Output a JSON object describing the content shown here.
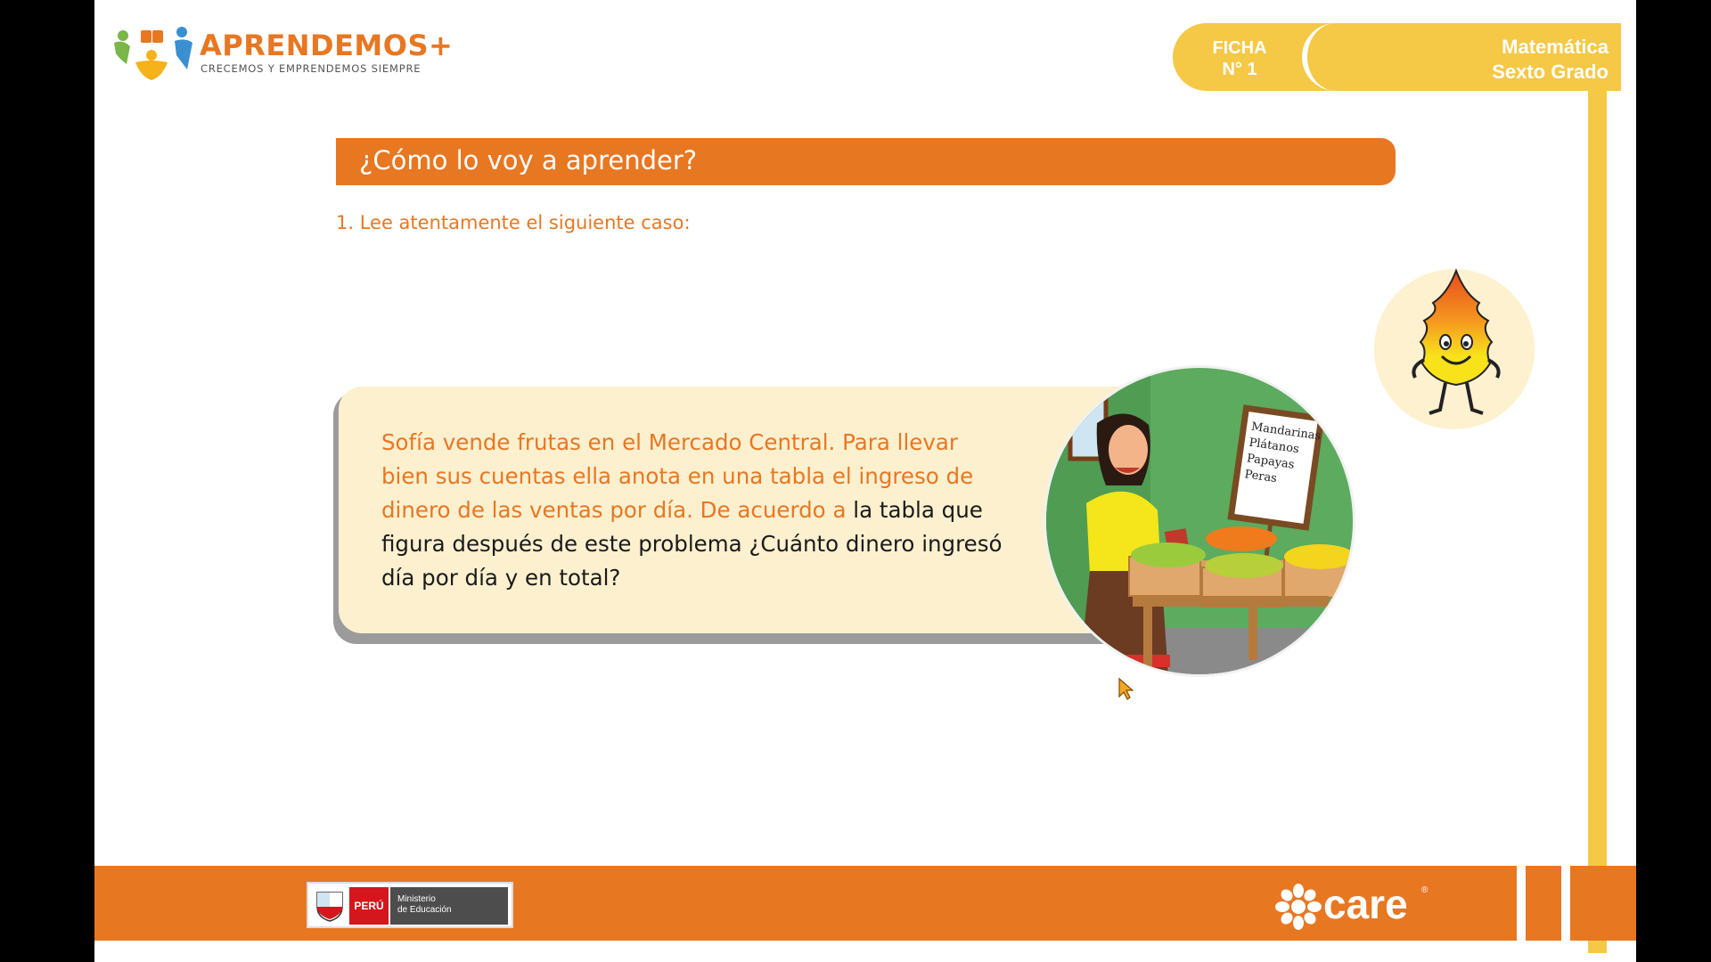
{
  "header": {
    "brand_title": "APRENDEMOS+",
    "brand_tagline": "CRECEMOS Y EMPRENDEMOS SIEMPRE",
    "ficha_line1": "FICHA",
    "ficha_line2": "N° 1",
    "subject_line1": "Matemática",
    "subject_line2": "Sexto Grado"
  },
  "section": {
    "title": "¿Cómo lo voy a aprender?",
    "step": "1. Lee atentamente el siguiente caso:"
  },
  "case": {
    "text_orange": "Sofía vende frutas en el Mercado Central. Para llevar bien sus cuentas ella anota en una tabla el ingreso de dinero de las ventas por día. De acuerdo a ",
    "text_dark": "la tabla que figura después de este problema ¿Cuánto dinero ingresó día por día y en total?"
  },
  "illustration": {
    "sign_items": [
      "Mandarinas",
      "Plátanos",
      "Papayas",
      "Peras"
    ]
  },
  "footer": {
    "country": "PERÚ",
    "ministry_line1": "Ministerio",
    "ministry_line2": "de Educación",
    "partner": "care",
    "partner_mark": "®"
  },
  "colors": {
    "orange": "#e87722",
    "yellow": "#f5c846",
    "cream": "#fdf0cf",
    "green": "#5cab5e"
  }
}
